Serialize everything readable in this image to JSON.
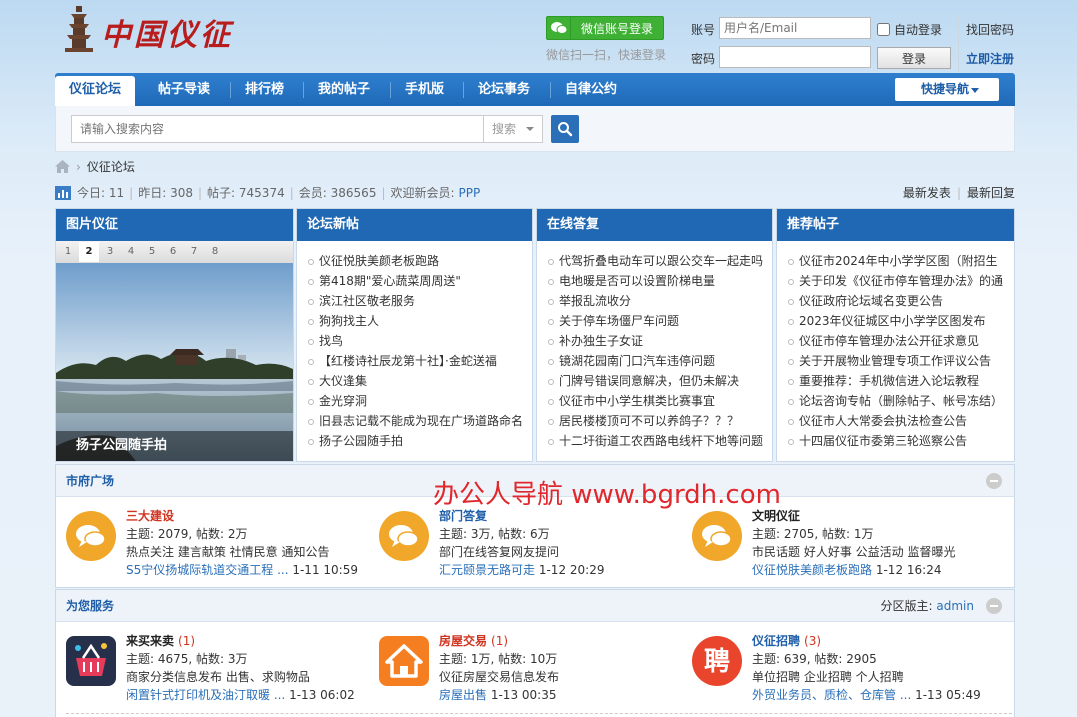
{
  "header": {
    "logo_text": "中国仪征",
    "wechat_button": "微信账号登录",
    "wechat_tip": "微信扫一扫，快速登录",
    "account_label": "账号",
    "account_placeholder": "用户名/Email",
    "password_label": "密码",
    "auto_login": "自动登录",
    "login_button": "登录",
    "find_password": "找回密码",
    "register": "立即注册"
  },
  "nav": {
    "items": [
      "仪征论坛",
      "帖子导读",
      "排行榜",
      "我的帖子",
      "手机版",
      "论坛事务",
      "自律公约"
    ],
    "quick_nav": "快捷导航"
  },
  "search": {
    "placeholder": "请输入搜索内容",
    "type": "搜索"
  },
  "breadcrumb": {
    "current": "仪征论坛"
  },
  "stats": {
    "today_label": "今日:",
    "today": "11",
    "yesterday_label": "昨日:",
    "yesterday": "308",
    "posts_label": "帖子:",
    "posts": "745374",
    "members_label": "会员:",
    "members": "386565",
    "new_member_label": "欢迎新会员:",
    "new_member": "PPP",
    "latest_posts": "最新发表",
    "latest_replies": "最新回复"
  },
  "panels": {
    "photo": {
      "title": "图片仪征",
      "tabs": [
        "1",
        "2",
        "3",
        "4",
        "5",
        "6",
        "7",
        "8"
      ],
      "active_tab": "2",
      "caption": "扬子公园随手拍"
    },
    "new_posts": {
      "title": "论坛新帖",
      "items": [
        "仪征悦肤美颜老板跑路",
        "第418期\"爱心蔬菜周周送\"",
        "滨江社区敬老服务",
        "狗狗找主人",
        "找鸟",
        "【红楼诗社辰龙第十社】·金蛇送福",
        "大仪逢集",
        "金光穿洞",
        "旧县志记载不能成为现在广场道路命名",
        "扬子公园随手拍"
      ]
    },
    "answers": {
      "title": "在线答复",
      "items": [
        "代驾折叠电动车可以跟公交车一起走吗",
        "电地暖是否可以设置阶梯电量",
        "举报乱流收分",
        "关于停车场僵尸车问题",
        "补办独生子女证",
        "镜湖花园南门口汽车违停问题",
        "门牌号错误同意解决，但仍未解决",
        "仪征市中小学生棋类比赛事宜",
        "居民楼楼顶可不可以养鸽子？？？",
        "十二圩街道工农西路电线杆下地等问题"
      ]
    },
    "recommended": {
      "title": "推荐帖子",
      "items": [
        "仪征市2024年中小学学区图（附招生",
        "关于印发《仪征市停车管理办法》的通",
        "仪征政府论坛域名变更公告",
        "2023年仪征城区中小学学区图发布",
        "仪征市停车管理办法公开征求意见",
        "关于开展物业管理专项工作评议公告",
        "重要推荐：手机微信进入论坛教程",
        "论坛咨询专帖（删除帖子、帐号冻结）",
        "仪征市人大常委会执法检查公告",
        "十四届仪征市委第三轮巡察公告"
      ]
    }
  },
  "watermark": "办公人导航  www.bgrdh.com",
  "sections": {
    "city": {
      "title": "市府广场",
      "forums": [
        {
          "name": "三大建设",
          "stats": "主题: 2079, 帖数: 2万",
          "tags": "热点关注  建言献策  社情民意  通知公告",
          "last_title": "S5宁仪扬城际轨道交通工程 ...",
          "last_time": "1-11 10:59"
        },
        {
          "name": "部门答复",
          "stats": "主题: 3万, 帖数: 6万",
          "tags": "部门在线答复网友提问",
          "last_title": "汇元颐景无路可走",
          "last_time": "1-12 20:29"
        },
        {
          "name": "文明仪征",
          "stats": "主题: 2705, 帖数: 1万",
          "tags": "市民话题  好人好事  公益活动  监督曝光",
          "last_title": "仪征悦肤美颜老板跑路",
          "last_time": "1-12 16:24"
        }
      ]
    },
    "service": {
      "title": "为您服务",
      "moderator_label": "分区版主:",
      "moderator": "admin",
      "forums": [
        {
          "name": "来买来卖",
          "count": "(1)",
          "stats": "主题: 4675, 帖数: 3万",
          "tags": "商家分类信息发布 出售、求购物品",
          "last_title": "闲置针式打印机及油汀取暖 ...",
          "last_time": "1-13 06:02"
        },
        {
          "name": "房屋交易",
          "count": "(1)",
          "stats": "主题: 1万, 帖数: 10万",
          "tags": "仪征房屋交易信息发布",
          "last_title": "房屋出售",
          "last_time": "1-13 00:35"
        },
        {
          "name": "仪征招聘",
          "count": "(3)",
          "stats": "主题: 639, 帖数: 2905",
          "tags": "单位招聘 企业招聘 个人招聘",
          "last_title": "外贸业务员、质检、仓库管 ...",
          "last_time": "1-13 05:49"
        }
      ]
    }
  },
  "colors": {
    "nav_blue": "#1f6ab8",
    "panel_head": "#2068b4",
    "wechat_green": "#3eb135",
    "forum_icon_orange": "#f0a72a",
    "watermark_red": "#e0282c"
  }
}
